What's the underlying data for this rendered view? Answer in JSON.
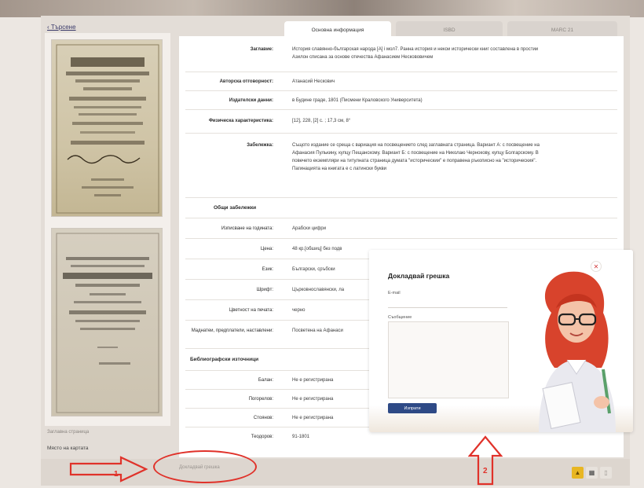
{
  "nav": {
    "back_label": "‹ Търсене"
  },
  "tabs": [
    {
      "label": "Основна информация"
    },
    {
      "label": "ISBD"
    },
    {
      "label": "MARC 21"
    }
  ],
  "record": {
    "title_lbl": "Заглавие:",
    "title_val": "История славянно-българская народа [А] і мол7. Ранна история и некои исторически книг составлена в простии Азилон списана за основе отечества Афанасием Нескововичем",
    "author_lbl": "Авторска отговорност:",
    "author_val": "Атанасий Нескович",
    "pub_lbl": "Издателски данни:",
    "pub_val": "в Будине граде, 1801 (Писмени Краловского Университета)",
    "phys_lbl": "Физическа характеристика:",
    "phys_val": "[12], 228, [2] с. ; 17,3 см, 8°",
    "notes_lbl": "Забележка:",
    "notes_val": "Същото издание се среща с вариация на посвещението след заглавната страница. Вариант А: с посвещение на Афанасия Пулькину, купцу Пещанскому. Вариант Б: с посвещение на Николаю Чернокову, купцу Болгарскому. В повечето екземпляри на титулната страница думата \"историческии\" е поправена ръкописно на \"историческия\". Пагинацията на книгата е с латински букви",
    "general_notes_section": "Общи забележки",
    "numbering_lbl": "Изписване на годината:",
    "numbering_val": "Арабски цифри",
    "price_lbl": "Цена:",
    "price_val": "48 кр.[обшиц] без подв",
    "lang_lbl": "Език:",
    "lang_val": "Български, сръбски",
    "font_lbl": "Шрифт:",
    "font_val": "Църковнославянски, ла",
    "color_lbl": "Цветност на печата:",
    "color_val": "черно",
    "dedic_lbl": "Маднатеи, предплатели, наставлени:",
    "dedic_val": "Посветена на Афанаси",
    "bib_section": "Библиографски източници",
    "b1_lbl": "Балан:",
    "b1_val": "Не е регистрирана",
    "b2_lbl": "Погорелов:",
    "b2_val": "Не е регистрирана",
    "b3_lbl": "Стоянов:",
    "b3_val": "Не е регистрирана",
    "b4_lbl": "Теодоров:",
    "b4_val": "91-1801"
  },
  "left": {
    "thumb_note": "Заглавна страница",
    "map_label": "Място на картата"
  },
  "footer": {
    "report_link": "Докладвай грешка"
  },
  "annotations": {
    "one": "1",
    "two": "2"
  },
  "modal": {
    "title": "Докладвай грешка",
    "email_label": "E-mail",
    "message_label": "Съобщение",
    "send_label": "Изпрати",
    "close_glyph": "✕"
  },
  "colors": {
    "annotation_red": "#e0322a",
    "button_blue": "#2e4a86"
  }
}
